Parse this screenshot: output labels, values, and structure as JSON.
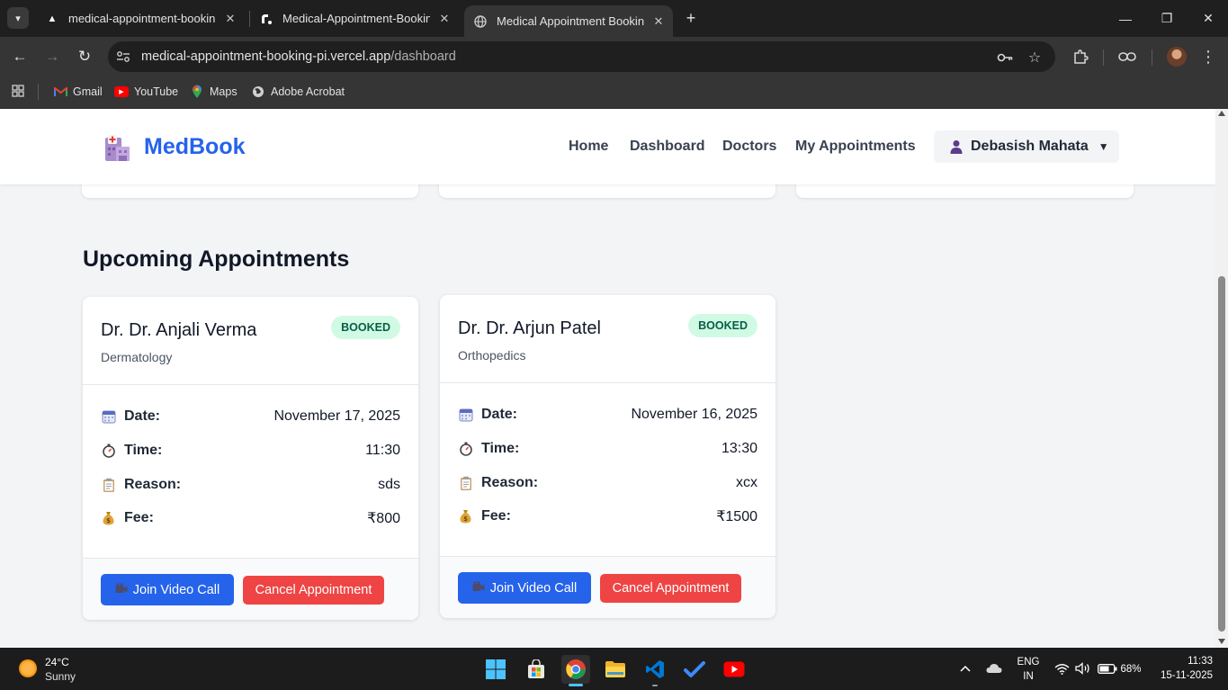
{
  "browser": {
    "tabs": [
      {
        "title": "medical-appointment-booking",
        "favicon": "vercel-triangle-icon"
      },
      {
        "title": "Medical-Appointment-Booking",
        "favicon": "render-icon"
      },
      {
        "title": "Medical Appointment Booking",
        "favicon": "globe-icon"
      }
    ],
    "url_host": "medical-appointment-booking-pi.vercel.app",
    "url_path": "/dashboard",
    "bookmarks": [
      "Gmail",
      "YouTube",
      "Maps",
      "Adobe Acrobat"
    ]
  },
  "site": {
    "logo": "MedBook",
    "nav": [
      "Home",
      "Dashboard",
      "Doctors",
      "My Appointments"
    ],
    "user_name": "Debasish Mahata",
    "section_title": "Upcoming Appointments"
  },
  "labels": {
    "date": "Date:",
    "time": "Time:",
    "reason": "Reason:",
    "fee": "Fee:",
    "join": "Join Video Call",
    "cancel": "Cancel Appointment"
  },
  "appointments": [
    {
      "doctor": "Dr. Dr. Anjali Verma",
      "specialty": "Dermatology",
      "status": "BOOKED",
      "date": "November 17, 2025",
      "time": "11:30",
      "reason": "sds",
      "fee": "₹800"
    },
    {
      "doctor": "Dr. Dr. Arjun Patel",
      "specialty": "Orthopedics",
      "status": "BOOKED",
      "date": "November 16, 2025",
      "time": "13:30",
      "reason": "xcx",
      "fee": "₹1500"
    }
  ],
  "colors": {
    "brand": "#2563eb",
    "badge_bg": "#d1fae5",
    "badge_text": "#065f46",
    "cancel": "#ef4444"
  },
  "taskbar": {
    "temperature": "24°C",
    "weather": "Sunny",
    "lang_top": "ENG",
    "lang_bottom": "IN",
    "battery": "68%",
    "time": "11:33",
    "date": "15-11-2025"
  }
}
